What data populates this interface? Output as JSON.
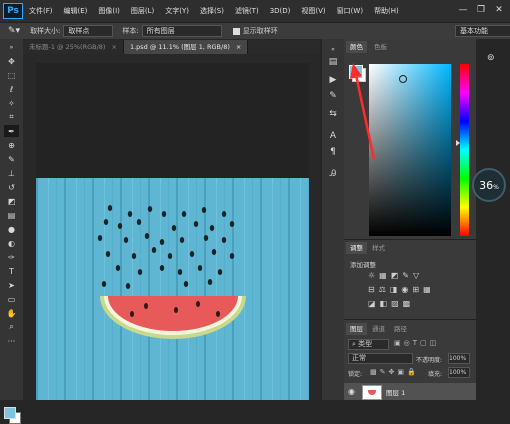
{
  "app": {
    "logo": "Ps"
  },
  "menu": [
    "文件(F)",
    "编辑(E)",
    "图像(I)",
    "图层(L)",
    "文字(Y)",
    "选择(S)",
    "滤镜(T)",
    "3D(D)",
    "视图(V)",
    "窗口(W)",
    "帮助(H)"
  ],
  "window_controls": {
    "minimize": "—",
    "restore": "❐",
    "close": "✕"
  },
  "options": {
    "sample_size_label": "取样大小:",
    "sample_size_value": "取样点",
    "sample_label": "样本:",
    "sample_value": "所有图层",
    "show_ring_label": "显示取样环",
    "workspace": "基本功能"
  },
  "tabs": [
    {
      "label": "未标题-1 @ 25%(RGB/8)",
      "close": "×"
    },
    {
      "label": "1.psd @ 11.1% (图层 1, RGB/8)",
      "close": "×"
    }
  ],
  "color_panel": {
    "tab_color": "颜色",
    "tab_swatches": "色板",
    "fg_color": "#7fc4de",
    "hue_color": "#00b8ff"
  },
  "adjust_panel": {
    "tab_adjust": "调整",
    "tab_styles": "样式",
    "add_label": "添加调整"
  },
  "layers_panel": {
    "tab_layers": "图层",
    "tab_channels": "通道",
    "tab_paths": "路径",
    "kind": "类型",
    "blend": "正常",
    "opacity_label": "不透明度:",
    "opacity_value": "100%",
    "lock_label": "锁定:",
    "fill_label": "填充:",
    "fill_value": "100%",
    "layer_name": "图层 1"
  },
  "badge": {
    "value": "36",
    "unit": "%"
  }
}
